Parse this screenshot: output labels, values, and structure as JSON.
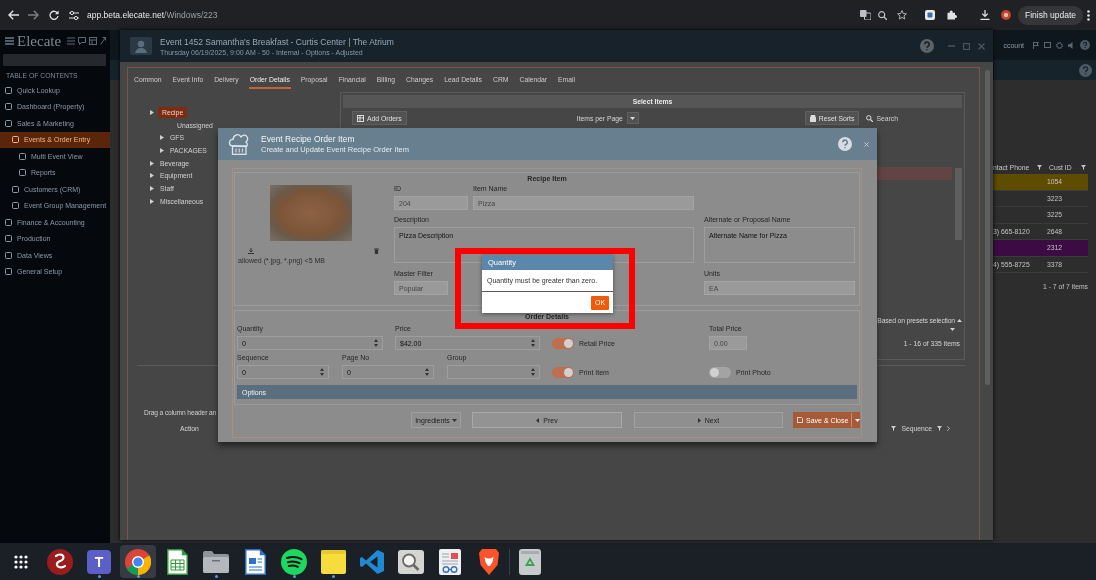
{
  "browser": {
    "url_host": "app.beta.elecate.net",
    "url_path": "/Windows/223",
    "update_button": "Finish update"
  },
  "sidebar": {
    "logo": "Elecate",
    "heading": "TABLE OF CONTENTS",
    "items": [
      {
        "label": "Quick Lookup",
        "selected": false
      },
      {
        "label": "Dashboard (Property)",
        "selected": false
      },
      {
        "label": "Sales & Marketing",
        "selected": false,
        "children": [
          {
            "label": "Events & Order Entry",
            "selected": true,
            "children": [
              {
                "label": "Multi Event View",
                "selected": false
              },
              {
                "label": "Reports",
                "selected": false
              }
            ]
          },
          {
            "label": "Customers (CRM)",
            "selected": false
          },
          {
            "label": "Event Group Management",
            "selected": false
          }
        ]
      },
      {
        "label": "Finance & Accounting",
        "selected": false
      },
      {
        "label": "Production",
        "selected": false
      },
      {
        "label": "Data Views",
        "selected": false
      },
      {
        "label": "General Setup",
        "selected": false
      }
    ]
  },
  "outer": {
    "header_text": "ccount",
    "table": {
      "columns": [
        "ntact Phone",
        "Cust ID"
      ],
      "rows": [
        {
          "cust_id": "1054",
          "color": "#5e4c00"
        },
        {
          "cust_id": "3223"
        },
        {
          "cust_id": "3225"
        },
        {
          "phone": "3) 665-8120",
          "cust_id": "2648"
        },
        {
          "cust_id": "2312",
          "color": "#3c0b44"
        },
        {
          "phone": "4) 555-8725",
          "cust_id": "3378"
        }
      ],
      "pager": "1 - 7 of 7 items"
    }
  },
  "window": {
    "title": "Event 1452 Samantha's Breakfast - Curtis Center | The Atrium",
    "subtitle": "Thursday 06/19/2025, 9:00 AM - 50 - Internal - Options - Adjusted",
    "tabs": [
      {
        "label": "Common",
        "selected": false
      },
      {
        "label": "Event Info",
        "selected": false
      },
      {
        "label": "Delivery",
        "selected": false
      },
      {
        "label": "Order Details",
        "selected": true
      },
      {
        "label": "Proposal",
        "selected": false
      },
      {
        "label": "Financial",
        "selected": false
      },
      {
        "label": "Billing",
        "selected": false
      },
      {
        "label": "Changes",
        "selected": false
      },
      {
        "label": "Lead Details",
        "selected": false
      },
      {
        "label": "CRM",
        "selected": false
      },
      {
        "label": "Calendar",
        "selected": false
      },
      {
        "label": "Email",
        "selected": false
      }
    ],
    "category_tree": [
      {
        "label": "Recipe",
        "kind": "folder",
        "selected": true,
        "children": [
          {
            "label": "Unassigned",
            "kind": "leaf",
            "selected": false
          },
          {
            "label": "GFS",
            "kind": "folder",
            "selected": false
          },
          {
            "label": "PACKAGES",
            "kind": "folder",
            "selected": false
          }
        ]
      },
      {
        "label": "Beverage",
        "kind": "folder",
        "selected": false
      },
      {
        "label": "Equipment",
        "kind": "folder",
        "selected": false
      },
      {
        "label": "Staff",
        "kind": "folder",
        "selected": false
      },
      {
        "label": "Miscellaneous",
        "kind": "folder",
        "selected": false
      }
    ],
    "select_items": {
      "title": "Select Items",
      "add_button": "Add Orders",
      "page_size_label": "Items per Page",
      "reset_button": "Reset Sorts",
      "search": {
        "placeholder": "Search"
      },
      "grid_rows": [
        {
          "selected": true
        }
      ],
      "preset_note": "Based on presets selection",
      "pager": "1 - 16 of 335 items"
    },
    "orders_grid": {
      "group_hint": "Drag a column header an",
      "columns": [
        "Action",
        "Sequence"
      ]
    }
  },
  "modal": {
    "title": "Event Recipe Order Item",
    "subtitle": "Create and Update Event Recipe Order Item",
    "recipe": {
      "title": "Recipe Item",
      "upload_hint": "allowed (*.jpg, *.png) <5 MB",
      "id": {
        "label": "ID",
        "value": "204",
        "disabled": true
      },
      "item_name": {
        "label": "Item Name",
        "value": "Pizza",
        "disabled": true
      },
      "description": {
        "label": "Description",
        "value": "Pizza Description",
        "disabled": false
      },
      "alternate_name": {
        "label": "Alternate or Proposal Name",
        "value": "Alternate Name for Pizza",
        "disabled": false
      },
      "master_filter": {
        "label": "Master Filter",
        "value": "Popular",
        "disabled": true
      },
      "units": {
        "label": "Units",
        "value": "EA",
        "disabled": true
      }
    },
    "order": {
      "title": "Order Details",
      "quantity": {
        "label": "Quantity",
        "value": "0",
        "disabled": false
      },
      "price": {
        "label": "Price",
        "value": "$42.00",
        "disabled": false
      },
      "retail_price": {
        "label": "Retail Price",
        "on": true
      },
      "total_price": {
        "label": "Total Price",
        "value": "0.00",
        "disabled": true
      },
      "sequence": {
        "label": "Sequence",
        "value": "0",
        "disabled": false
      },
      "page_no": {
        "label": "Page No",
        "value": "0",
        "disabled": false
      },
      "group": {
        "label": "Group"
      },
      "print_item": {
        "label": "Print Item",
        "on": true
      },
      "print_photo": {
        "label": "Print Photo",
        "on": false
      },
      "options_bar": "Options"
    },
    "footer": {
      "ingredients": "Ingredients",
      "prev": "Prev",
      "next": "Next",
      "save": "Save & Close"
    }
  },
  "dialog": {
    "title": "Quantity",
    "message": "Quantity must be greater than zero.",
    "ok_button": "OK"
  },
  "taskbar": [
    {
      "kind": "app-grid",
      "running": false,
      "selected": false
    },
    {
      "kind": "swirl",
      "running": false,
      "selected": false
    },
    {
      "kind": "letter-tile",
      "glyph": "T",
      "running": true,
      "selected": false
    },
    {
      "kind": "browser",
      "running": true,
      "selected": true
    },
    {
      "kind": "spreadsheet",
      "running": false,
      "selected": false
    },
    {
      "kind": "files",
      "running": true,
      "selected": false
    },
    {
      "kind": "document",
      "running": false,
      "selected": false
    },
    {
      "kind": "music",
      "running": true,
      "selected": false
    },
    {
      "kind": "notes",
      "running": true,
      "selected": false
    },
    {
      "kind": "code-editor",
      "running": false,
      "selected": false
    },
    {
      "kind": "magnifier",
      "running": false,
      "selected": false
    },
    {
      "kind": "reader",
      "running": false,
      "selected": false
    },
    {
      "kind": "shield",
      "running": false,
      "selected": false
    },
    {
      "kind": "trash",
      "running": false,
      "selected": false
    }
  ]
}
